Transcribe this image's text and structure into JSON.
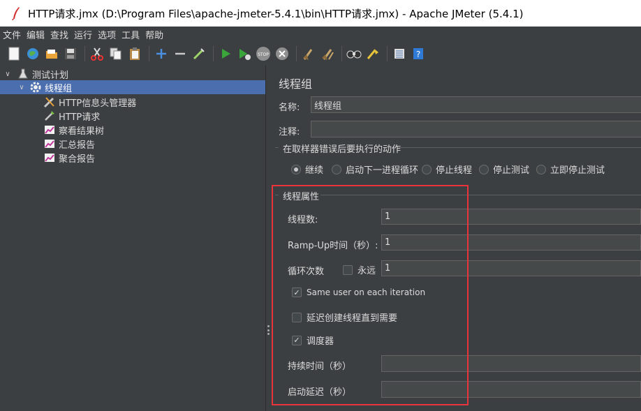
{
  "window": {
    "title": "HTTP请求.jmx (D:\\Program Files\\apache-jmeter-5.4.1\\bin\\HTTP请求.jmx) - Apache JMeter (5.4.1)"
  },
  "menu": [
    "文件",
    "编辑",
    "查找",
    "运行",
    "选项",
    "工具",
    "帮助"
  ],
  "toolbar": [
    "new-icon",
    "templates-icon",
    "open-icon",
    "save-icon",
    "cut-icon",
    "copy-icon",
    "paste-icon",
    "expand-icon",
    "collapse-icon",
    "toggle-icon",
    "start-icon",
    "start-no-pause-icon",
    "stop-icon",
    "shutdown-icon",
    "clear-icon",
    "clear-all-icon",
    "search-icon",
    "reset-search-icon",
    "function-helper-icon",
    "help-icon"
  ],
  "tree": {
    "root": "测试计划",
    "thread_group": "线程组",
    "children": [
      "HTTP信息头管理器",
      "HTTP请求",
      "察看结果树",
      "汇总报告",
      "聚合报告"
    ]
  },
  "panel": {
    "title": "线程组",
    "name_label": "名称:",
    "name_value": "线程组",
    "comment_label": "注释:",
    "comment_value": "",
    "error_action_title": "在取样器错误后要执行的动作",
    "error_actions": [
      "继续",
      "启动下一进程循环",
      "停止线程",
      "停止测试",
      "立即停止测试"
    ],
    "selected_error_action": "继续",
    "thread_props_title": "线程属性",
    "threads_label": "线程数:",
    "threads_value": "1",
    "rampup_label": "Ramp-Up时间（秒）:",
    "rampup_value": "1",
    "loop_label": "循环次数",
    "forever_label": "永远",
    "loop_value": "1",
    "same_user_label": "Same user on each iteration",
    "same_user_checked": true,
    "delay_create_label": "延迟创建线程直到需要",
    "delay_create_checked": false,
    "scheduler_label": "调度器",
    "scheduler_checked": true,
    "duration_label": "持续时间（秒）",
    "duration_value": "",
    "startup_delay_label": "启动延迟（秒）",
    "startup_delay_value": ""
  }
}
